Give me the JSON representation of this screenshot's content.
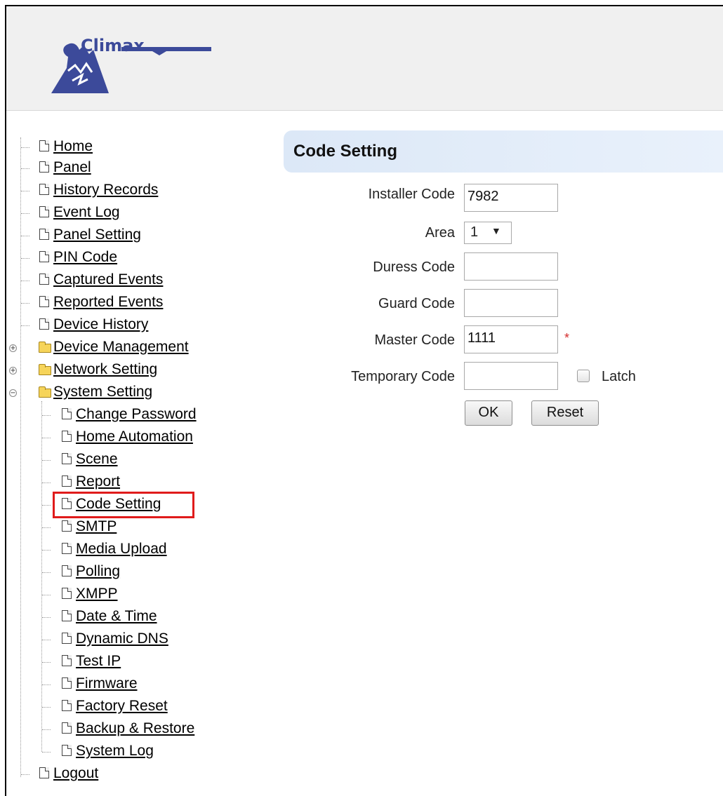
{
  "brand": {
    "name": "Climax"
  },
  "nav": {
    "items": [
      {
        "label": "Home",
        "name": "nav-home"
      },
      {
        "label": "Panel",
        "name": "nav-panel"
      },
      {
        "label": "History Records",
        "name": "nav-history-records"
      },
      {
        "label": "Event Log",
        "name": "nav-event-log"
      },
      {
        "label": "Panel Setting",
        "name": "nav-panel-setting"
      },
      {
        "label": "PIN Code",
        "name": "nav-pin-code"
      },
      {
        "label": "Captured Events",
        "name": "nav-captured-events"
      },
      {
        "label": "Reported Events",
        "name": "nav-reported-events"
      },
      {
        "label": "Device History",
        "name": "nav-device-history"
      }
    ],
    "folders": [
      {
        "label": "Device Management",
        "name": "nav-device-management",
        "expanded": false
      },
      {
        "label": "Network Setting",
        "name": "nav-network-setting",
        "expanded": false
      },
      {
        "label": "System Setting",
        "name": "nav-system-setting",
        "expanded": true
      }
    ],
    "system_children": [
      {
        "label": "Change Password",
        "name": "nav-change-password"
      },
      {
        "label": "Home Automation",
        "name": "nav-home-automation"
      },
      {
        "label": "Scene",
        "name": "nav-scene"
      },
      {
        "label": "Report",
        "name": "nav-report"
      },
      {
        "label": "Code Setting",
        "name": "nav-code-setting",
        "selected": true
      },
      {
        "label": "SMTP",
        "name": "nav-smtp"
      },
      {
        "label": "Media Upload",
        "name": "nav-media-upload"
      },
      {
        "label": "Polling",
        "name": "nav-polling"
      },
      {
        "label": "XMPP",
        "name": "nav-xmpp"
      },
      {
        "label": "Date & Time",
        "name": "nav-date-time"
      },
      {
        "label": "Dynamic DNS",
        "name": "nav-dynamic-dns"
      },
      {
        "label": "Test IP",
        "name": "nav-test-ip"
      },
      {
        "label": "Firmware",
        "name": "nav-firmware"
      },
      {
        "label": "Factory Reset",
        "name": "nav-factory-reset"
      },
      {
        "label": "Backup & Restore",
        "name": "nav-backup-restore"
      },
      {
        "label": "System Log",
        "name": "nav-system-log"
      }
    ],
    "logout": {
      "label": "Logout"
    }
  },
  "page": {
    "title": "Code Setting",
    "fields": {
      "installer_code": {
        "label": "Installer Code",
        "value": "7982"
      },
      "area": {
        "label": "Area",
        "value": "1"
      },
      "duress_code": {
        "label": "Duress Code",
        "value": ""
      },
      "guard_code": {
        "label": "Guard Code",
        "value": ""
      },
      "master_code": {
        "label": "Master Code",
        "value": "1111",
        "required_mark": "*"
      },
      "temporary_code": {
        "label": "Temporary Code",
        "value": ""
      }
    },
    "latch_label": "Latch",
    "ok_label": "OK",
    "reset_label": "Reset"
  },
  "colors": {
    "highlight": "#e01b1b",
    "title_bar": "#dce8f7",
    "brand": "#3c4a9a"
  }
}
